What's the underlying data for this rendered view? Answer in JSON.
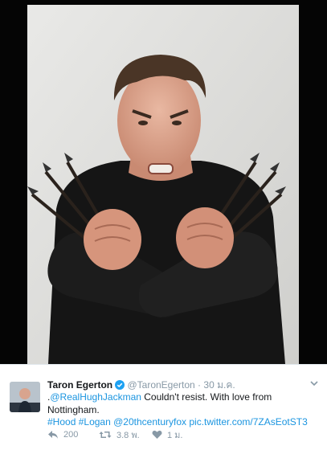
{
  "photo": {
    "alt": "",
    "subject": "man-with-crossed-arms-holding-arrows"
  },
  "tweet": {
    "author_name": "Taron Egerton",
    "author_handle": "@TaronEgerton",
    "separator": "·",
    "timestamp": "30 ม.ค.",
    "verified": true,
    "text_prefix": ".",
    "mention_1": "@RealHughJackman",
    "text_body": " Couldn't resist. With love from Nottingham.",
    "hashtag_1": "#Hood",
    "hashtag_2": "#Logan",
    "mention_2": "@20thcenturyfox",
    "pic_link": "pic.twitter.com/7ZAsEotST3",
    "replies": "200",
    "retweets": "3.8 พ.",
    "likes": "1 ม."
  },
  "colors": {
    "link": "#1b95e0",
    "muted": "#8899a6",
    "text": "#14171a",
    "verified": "#1da1f2"
  },
  "icons": {
    "reply": "reply-icon",
    "retweet": "retweet-icon",
    "like": "heart-icon",
    "menu": "chevron-down-icon",
    "verified": "verified-badge-icon"
  }
}
